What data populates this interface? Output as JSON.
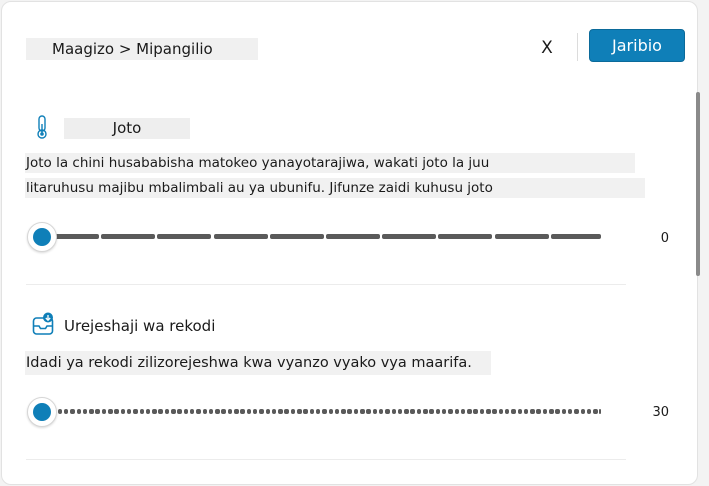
{
  "header": {
    "breadcrumb": "Maagizo > Mipangilio",
    "close_label": "X",
    "try_label": "Jaribio"
  },
  "temperature": {
    "icon": "thermometer-icon",
    "title": "Joto",
    "description_line1": "Joto la chini husababisha matokeo yanayotarajiwa, wakati joto la juu",
    "description_line2": "litaruhusu majibu mbalimbali au ya ubunifu. Jifunze zaidi kuhusu joto",
    "value": "0",
    "slider_min": 0,
    "slider_max": 1
  },
  "records": {
    "icon": "records-download-icon",
    "title": "Urejeshaji wa rekodi",
    "description": "Idadi ya rekodi zilizorejeshwa kwa vyanzo vyako vya maarifa.",
    "value": "30"
  },
  "colors": {
    "accent": "#0f7fb8",
    "track": "#5a5a5a"
  }
}
